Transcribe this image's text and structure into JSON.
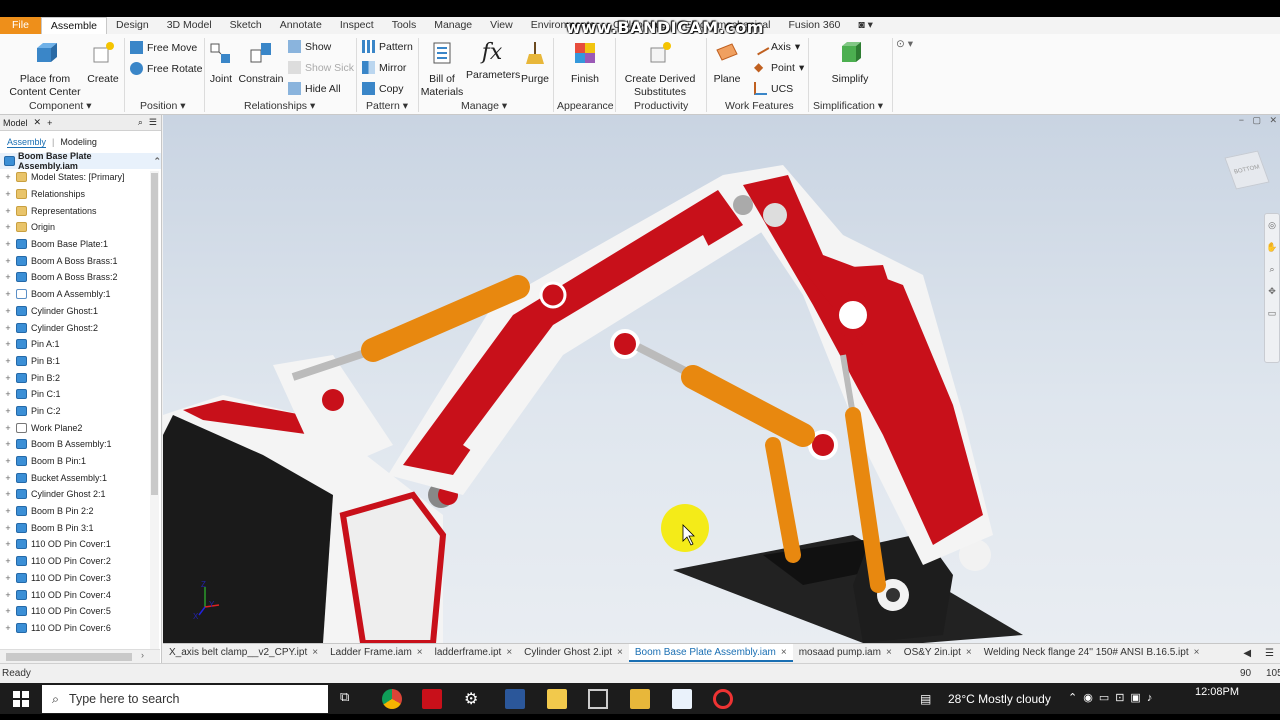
{
  "ribbon_tabs": [
    "File",
    "Assemble",
    "Design",
    "3D Model",
    "Sketch",
    "Annotate",
    "Inspect",
    "Tools",
    "Manage",
    "View",
    "Environments",
    "Collaborate",
    "Electromechanical",
    "Fusion 360"
  ],
  "watermark": "www.BANDICAM.com",
  "ribbon": {
    "place_from_content_center": "Place from Content Center",
    "create": "Create",
    "free_move": "Free Move",
    "free_rotate": "Free Rotate",
    "joint": "Joint",
    "constrain": "Constrain",
    "show": "Show",
    "show_sick": "Show Sick",
    "hide_all": "Hide All",
    "pattern": "Pattern",
    "mirror": "Mirror",
    "copy": "Copy",
    "bill_of_materials": "Bill of Materials",
    "parameters": "Parameters",
    "purge": "Purge",
    "finish": "Finish",
    "create_derived_substitutes": "Create Derived Substitutes",
    "plane": "Plane",
    "axis": "Axis",
    "point": "Point",
    "ucs": "UCS",
    "simplify": "Simplify",
    "groups": {
      "component": "Component",
      "position": "Position",
      "relationships": "Relationships",
      "pattern": "Pattern",
      "manage": "Manage",
      "appearance": "Appearance",
      "productivity": "Productivity",
      "work_features": "Work Features",
      "simplification": "Simplification"
    }
  },
  "browser": {
    "panel_title": "Model",
    "tabs": [
      "Assembly",
      "Modeling"
    ],
    "root": "Boom Base Plate Assembly.iam",
    "items": [
      {
        "label": "Model States: [Primary]",
        "type": "folder"
      },
      {
        "label": "Relationships",
        "type": "folder"
      },
      {
        "label": "Representations",
        "type": "folder"
      },
      {
        "label": "Origin",
        "type": "folder"
      },
      {
        "label": "Boom Base Plate:1",
        "type": "part"
      },
      {
        "label": "Boom  A Boss Brass:1",
        "type": "part"
      },
      {
        "label": "Boom  A Boss Brass:2",
        "type": "part"
      },
      {
        "label": "Boom A Assembly:1",
        "type": "asm"
      },
      {
        "label": "Cylinder Ghost:1",
        "type": "part"
      },
      {
        "label": "Cylinder Ghost:2",
        "type": "part"
      },
      {
        "label": "Pin A:1",
        "type": "part"
      },
      {
        "label": "Pin B:1",
        "type": "part"
      },
      {
        "label": "Pin B:2",
        "type": "part"
      },
      {
        "label": "Pin C:1",
        "type": "part"
      },
      {
        "label": "Pin C:2",
        "type": "part"
      },
      {
        "label": "Work Plane2",
        "type": "plane"
      },
      {
        "label": "Boom B Assembly:1",
        "type": "part"
      },
      {
        "label": "Boom  B Pin:1",
        "type": "part"
      },
      {
        "label": "Bucket Assembly:1",
        "type": "part"
      },
      {
        "label": "Cylinder Ghost 2:1",
        "type": "part"
      },
      {
        "label": "Boom  B Pin 2:2",
        "type": "part"
      },
      {
        "label": "Boom  B Pin 3:1",
        "type": "part"
      },
      {
        "label": "110 OD Pin Cover:1",
        "type": "part"
      },
      {
        "label": "110 OD Pin Cover:2",
        "type": "part"
      },
      {
        "label": "110 OD Pin Cover:3",
        "type": "part"
      },
      {
        "label": "110 OD Pin Cover:4",
        "type": "part"
      },
      {
        "label": "110 OD Pin Cover:5",
        "type": "part"
      },
      {
        "label": "110 OD Pin Cover:6",
        "type": "part"
      }
    ]
  },
  "viewcube_label": "BOTTOM",
  "doc_tabs": [
    {
      "label": "X_axis belt clamp__v2_CPY.ipt",
      "active": false
    },
    {
      "label": "Ladder Frame.iam",
      "active": false
    },
    {
      "label": "ladderframe.ipt",
      "active": false
    },
    {
      "label": "Cylinder Ghost 2.ipt",
      "active": false
    },
    {
      "label": "Boom Base Plate Assembly.iam",
      "active": true
    },
    {
      "label": "mosaad pump.iam",
      "active": false
    },
    {
      "label": "OS&Y 2in.ipt",
      "active": false
    },
    {
      "label": "Welding Neck flange 24'' 150# ANSI B.16.5.ipt",
      "active": false
    }
  ],
  "status": {
    "text": "Ready",
    "num1": "90",
    "num2": "105"
  },
  "taskbar": {
    "search_placeholder": "Type here to search",
    "weather": "28°C  Mostly cloudy",
    "time": "12:08PM"
  },
  "colors": {
    "file_tab": "#ee8f1a",
    "accent_blue": "#1a6fb3",
    "model_red": "#c8101a",
    "cylinder_orange": "#e8880f"
  }
}
